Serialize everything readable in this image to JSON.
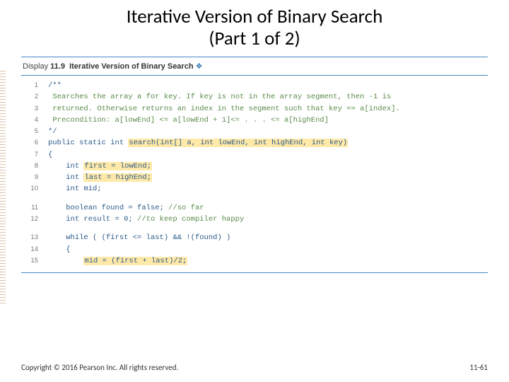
{
  "title_line1": "Iterative Version of Binary Search",
  "title_line2": "(Part 1 of 2)",
  "display": {
    "label": "Display",
    "number": "11.9",
    "title": "Iterative Version of Binary Search",
    "diamond": "❖"
  },
  "code": {
    "lines": [
      {
        "n": "1",
        "segs": [
          {
            "t": "/**"
          }
        ]
      },
      {
        "n": "2",
        "segs": [
          {
            "t": " ",
            "pre": true
          },
          {
            "t": "Searches the array a for key. If key is not in the array segment, then -1 is",
            "cls": "gr"
          }
        ]
      },
      {
        "n": "3",
        "segs": [
          {
            "t": " ",
            "pre": true
          },
          {
            "t": "returned. Otherwise returns an index in the segment such that key == a[index].",
            "cls": "gr"
          }
        ]
      },
      {
        "n": "4",
        "segs": [
          {
            "t": " ",
            "pre": true
          },
          {
            "t": "Precondition: a[lowEnd] <= a[lowEnd + 1]<= . . . <= a[highEnd]",
            "cls": "gr"
          }
        ]
      },
      {
        "n": "5",
        "segs": [
          {
            "t": "*/"
          }
        ]
      },
      {
        "n": "6",
        "segs": [
          {
            "t": "public static int ",
            "cls": "kw"
          },
          {
            "t": "search(int[] a, int lowEnd, int highEnd, int key)",
            "cls": "hl"
          }
        ]
      },
      {
        "n": "7",
        "segs": [
          {
            "t": "{"
          }
        ]
      },
      {
        "n": "8",
        "segs": [
          {
            "t": "    ",
            "pre": true
          },
          {
            "t": "int ",
            "cls": "kw"
          },
          {
            "t": "first = lowEnd;",
            "cls": "hl"
          }
        ]
      },
      {
        "n": "9",
        "segs": [
          {
            "t": "    ",
            "pre": true
          },
          {
            "t": "int ",
            "cls": "kw"
          },
          {
            "t": "last = highEnd;",
            "cls": "hl"
          }
        ]
      },
      {
        "n": "10",
        "segs": [
          {
            "t": "    ",
            "pre": true
          },
          {
            "t": "int mid;",
            "cls": "kw"
          }
        ]
      },
      {
        "n": "11",
        "gap": true,
        "segs": [
          {
            "t": "    ",
            "pre": true
          },
          {
            "t": "boolean found = false;",
            "cls": "kw"
          },
          {
            "t": " //so far",
            "cls": "gr"
          }
        ]
      },
      {
        "n": "12",
        "segs": [
          {
            "t": "    ",
            "pre": true
          },
          {
            "t": "int result = 0;",
            "cls": "kw"
          },
          {
            "t": " //to keep compiler happy",
            "cls": "gr"
          }
        ]
      },
      {
        "n": "13",
        "gap": true,
        "segs": [
          {
            "t": "    ",
            "pre": true
          },
          {
            "t": "while ( (first <= last) && !(found) )",
            "cls": "kw"
          }
        ]
      },
      {
        "n": "14",
        "segs": [
          {
            "t": "    {",
            "pre": true
          }
        ]
      },
      {
        "n": "15",
        "segs": [
          {
            "t": "        ",
            "pre": true
          },
          {
            "t": "mid = (first + last)/2;",
            "cls": "hl"
          }
        ]
      }
    ]
  },
  "footer": {
    "copyright": "Copyright © 2016 Pearson Inc. All rights reserved.",
    "pagenum": "11-61"
  }
}
